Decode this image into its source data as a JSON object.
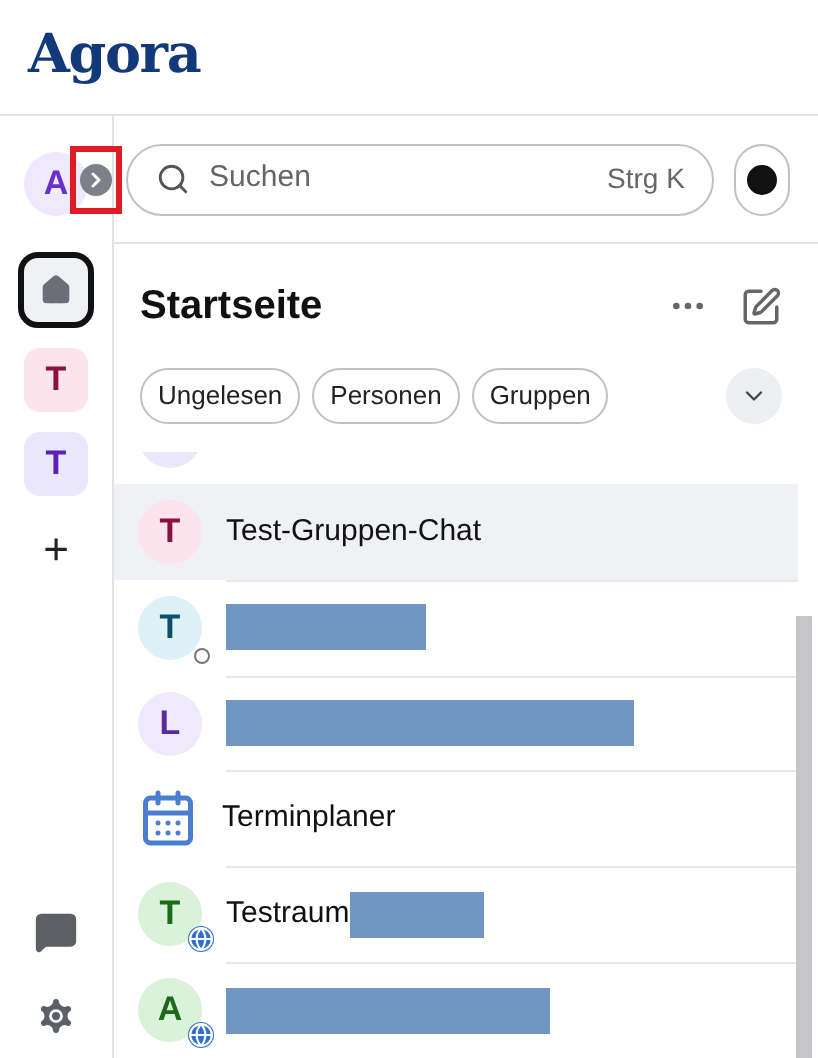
{
  "app": {
    "logo": "Agora"
  },
  "rail": {
    "account": {
      "letter": "A",
      "color": "#6b2fc9"
    },
    "spaces": [
      {
        "kind": "home",
        "selected": true
      },
      {
        "kind": "avatar",
        "letter": "T",
        "color": "#8a1040",
        "selected": false
      },
      {
        "kind": "avatar",
        "letter": "T",
        "color": "#5b21b6",
        "selected": false
      },
      {
        "kind": "add",
        "label": "+",
        "selected": false
      }
    ]
  },
  "search": {
    "placeholder": "Suchen",
    "shortcut": "Strg K",
    "expand_highlighted": true
  },
  "home": {
    "title": "Startseite",
    "filters": [
      {
        "label": "Ungelesen",
        "selected": false
      },
      {
        "label": "Personen",
        "selected": false
      },
      {
        "label": "Gruppen",
        "selected": false
      }
    ],
    "rooms": [
      {
        "kind": "avatar",
        "color": "#ece8fb",
        "selected": false
      },
      {
        "kind": "avatar",
        "letter": "T",
        "color": "#8a1040",
        "name": "Test-Gruppen-Chat",
        "selected": true
      },
      {
        "kind": "avatar",
        "letter": "T",
        "color": "#0b4f6c",
        "presence": true,
        "redacted": true,
        "selected": false
      },
      {
        "kind": "avatar",
        "letter": "L",
        "color": "#5b2a9a",
        "redacted": true,
        "selected": false
      },
      {
        "kind": "calendar",
        "name": "Terminplaner",
        "selected": false
      },
      {
        "kind": "avatar",
        "letter": "T",
        "color": "#1a6b1a",
        "name": "Testraum",
        "public": true,
        "redacted": true,
        "selected": false
      },
      {
        "kind": "avatar",
        "letter": "A",
        "color": "#1a6b1a",
        "public": true,
        "redacted": true,
        "selected": false
      }
    ]
  }
}
